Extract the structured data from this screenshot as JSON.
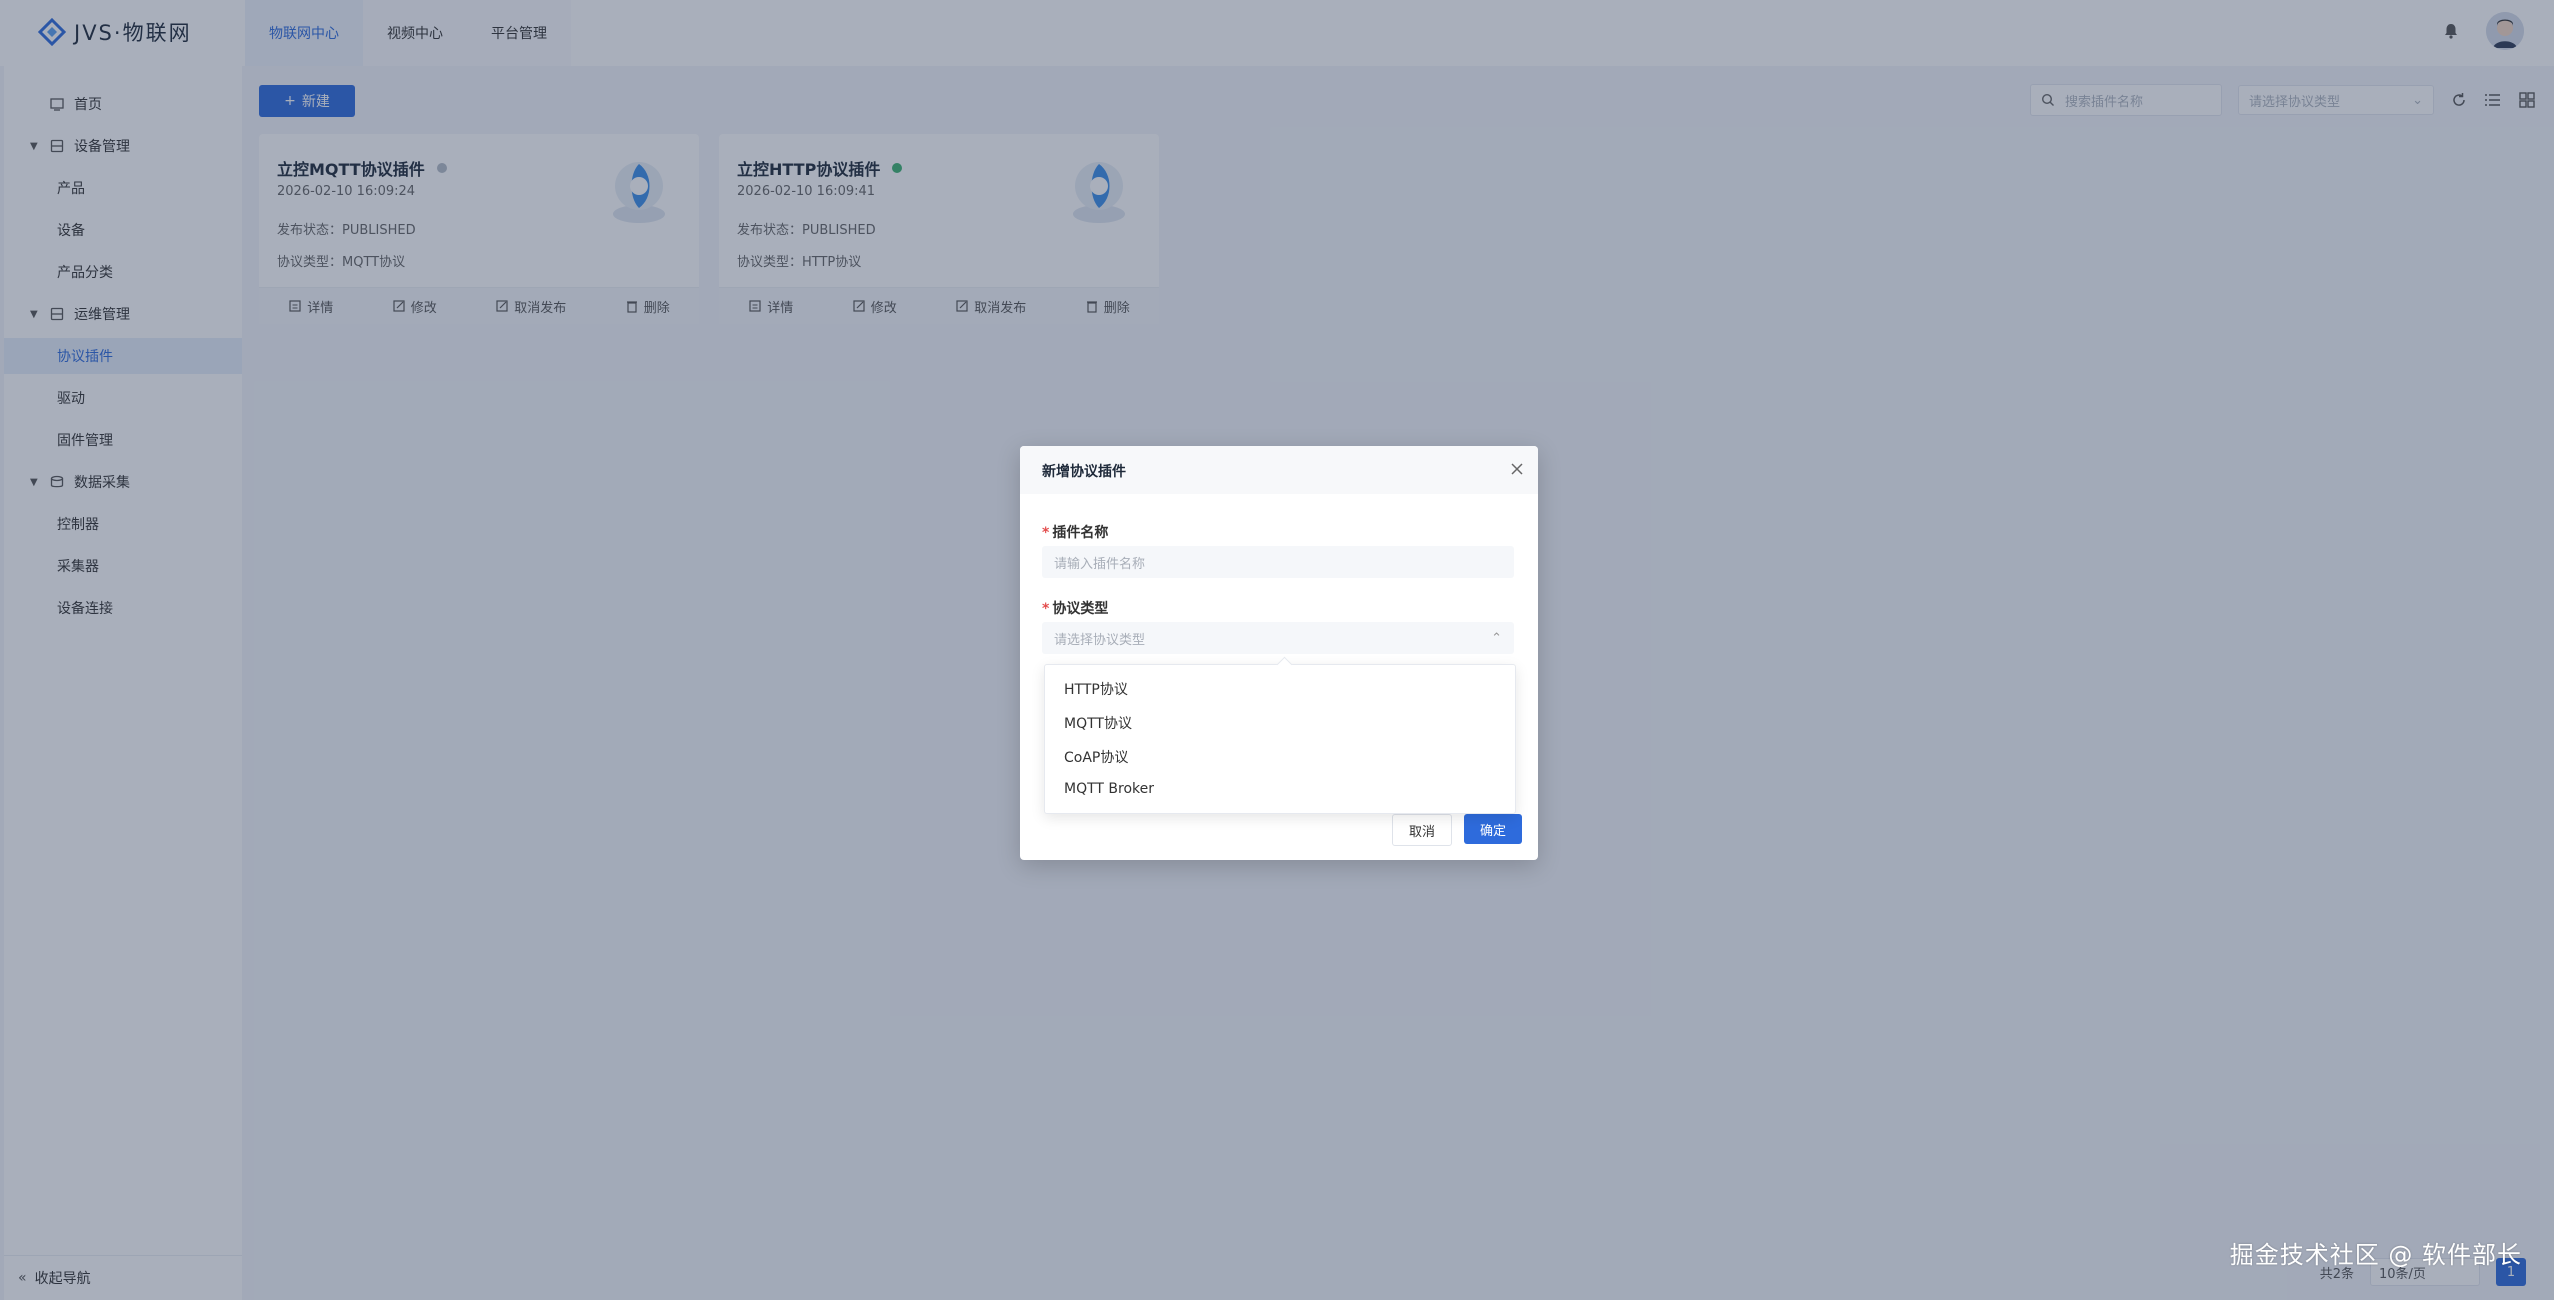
{
  "brand": {
    "name": "JVS·物联网"
  },
  "topnav": [
    {
      "label": "物联网中心",
      "active": true
    },
    {
      "label": "视频中心",
      "active": false
    },
    {
      "label": "平台管理",
      "active": false
    }
  ],
  "sidebar": {
    "items": [
      {
        "label": "首页"
      },
      {
        "label": "设备管理"
      },
      {
        "label": "产品"
      },
      {
        "label": "设备"
      },
      {
        "label": "产品分类"
      },
      {
        "label": "运维管理"
      },
      {
        "label": "协议插件"
      },
      {
        "label": "驱动"
      },
      {
        "label": "固件管理"
      },
      {
        "label": "数据采集"
      },
      {
        "label": "控制器"
      },
      {
        "label": "采集器"
      },
      {
        "label": "设备连接"
      }
    ],
    "collapse_label": "收起导航"
  },
  "toolbar": {
    "new_label": "新建",
    "search_placeholder": "搜索插件名称",
    "type_placeholder": "请选择协议类型"
  },
  "cards": [
    {
      "title": "立控MQTT协议插件",
      "status_color": "#b5bcc6",
      "time": "2026-02-10 16:09:24",
      "publish_status": "发布状态：PUBLISHED",
      "protocol_type": "协议类型：MQTT协议",
      "actions": [
        "详情",
        "修改",
        "取消发布",
        "删除"
      ]
    },
    {
      "title": "立控HTTP协议插件",
      "status_color": "#3cb371",
      "time": "2026-02-10 16:09:41",
      "publish_status": "发布状态：PUBLISHED",
      "protocol_type": "协议类型：HTTP协议",
      "actions": [
        "详情",
        "修改",
        "取消发布",
        "删除"
      ]
    }
  ],
  "pager": {
    "total": "共2条",
    "page_size": "10条/页",
    "page": "1"
  },
  "watermark": "掘金技术社区 @ 软件部长",
  "modal": {
    "title": "新增协议插件",
    "name_label": "插件名称",
    "name_placeholder": "请输入插件名称",
    "type_label": "协议类型",
    "type_placeholder": "请选择协议类型",
    "options": [
      "HTTP协议",
      "MQTT协议",
      "CoAP协议",
      "MQTT Broker"
    ],
    "cancel_label": "取消",
    "ok_label": "确定"
  },
  "colors": {
    "accent": "#2e6bdc",
    "overlay": "rgba(40,56,86,0.40)"
  }
}
